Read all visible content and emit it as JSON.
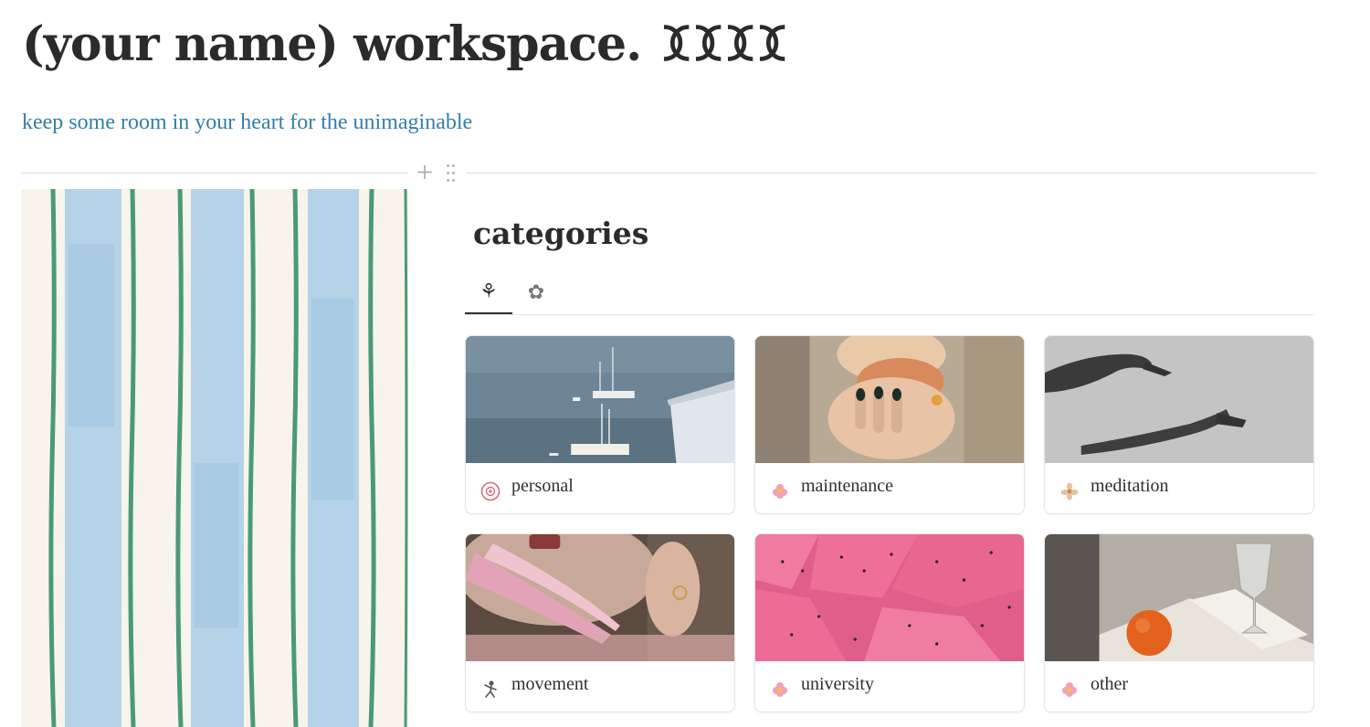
{
  "page": {
    "title": "(your name) workspace.",
    "title_glyphs": "ꘉꘉꘉꘉ",
    "subtitle": "keep some room in your heart for the unimaginable",
    "subtitle_color": "#337ea9"
  },
  "block_controls": {
    "add_symbol": "+"
  },
  "categories": {
    "heading": "categories",
    "tabs": [
      {
        "icon": "tulip-icon",
        "glyph": "⚘",
        "active": true
      },
      {
        "icon": "flower-icon",
        "glyph": "✿",
        "active": false
      }
    ],
    "cards": [
      {
        "label": "personal",
        "icon": "pink-flower-icon",
        "cover": "sailboats-on-sea"
      },
      {
        "label": "maintenance",
        "icon": "pink-flower-icon",
        "cover": "hands-holding-cup"
      },
      {
        "label": "meditation",
        "icon": "pale-flower-icon",
        "cover": "reaching-hands"
      },
      {
        "label": "movement",
        "icon": "dancer-icon",
        "cover": "pink-hair-clip"
      },
      {
        "label": "university",
        "icon": "pink-flower-icon",
        "cover": "dragonfruit-slices"
      },
      {
        "label": "other",
        "icon": "pink-flower-icon",
        "cover": "orange-on-book"
      }
    ]
  }
}
